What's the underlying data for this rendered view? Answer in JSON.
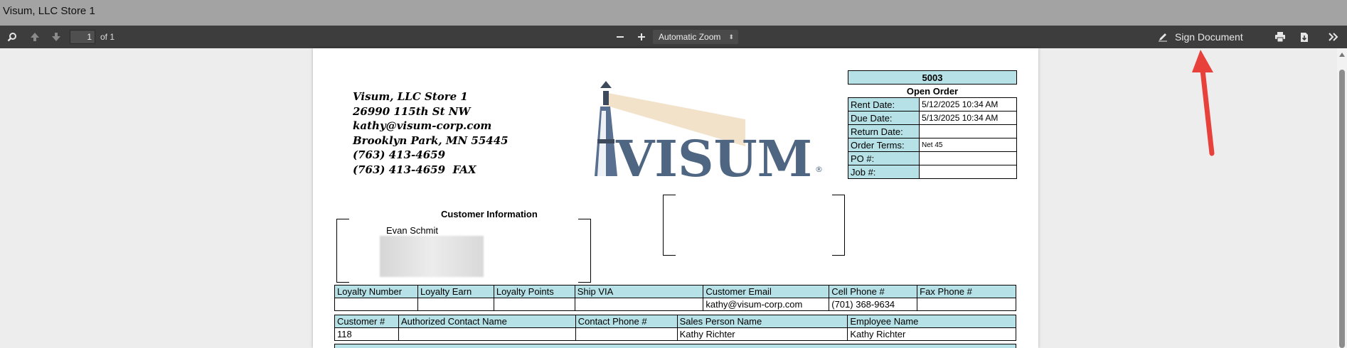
{
  "window": {
    "title": "Visum, LLC Store 1"
  },
  "toolbar": {
    "page_current": "1",
    "page_of": "of 1",
    "zoom_label": "Automatic Zoom",
    "sign_label": "Sign Document"
  },
  "store": {
    "name": "Visum, LLC Store 1",
    "street": "26990 115th St NW",
    "email": "kathy@visum-corp.com",
    "city": "Brooklyn Park, MN 55445",
    "phone": "(763) 413-4659",
    "fax": "(763) 413-4659  FAX"
  },
  "logo": {
    "text": "VISUM",
    "mark": "®"
  },
  "order": {
    "number": "5003",
    "status": "Open Order",
    "rows": [
      {
        "label": "Rent Date:",
        "value": "5/12/2025 10:34 AM"
      },
      {
        "label": "Due Date:",
        "value": "5/13/2025 10:34 AM"
      },
      {
        "label": "Return Date:",
        "value": ""
      },
      {
        "label": "Order Terms:",
        "value": "Net 45"
      },
      {
        "label": "PO #:",
        "value": ""
      },
      {
        "label": "Job #:",
        "value": ""
      }
    ]
  },
  "customer": {
    "title": "Customer Information",
    "name": "Evan Schmit"
  },
  "loyalty": {
    "headers": [
      "Loyalty Number",
      "Loyalty Earn",
      "Loyalty Points",
      "Ship VIA",
      "Customer Email",
      "Cell Phone #",
      "Fax Phone #"
    ],
    "values": [
      "",
      "",
      "",
      "",
      "kathy@visum-corp.com",
      "(701) 368-9634",
      ""
    ]
  },
  "contact": {
    "headers": [
      "Customer #",
      "Authorized Contact Name",
      "Contact Phone #",
      "Sales Person Name",
      "Employee Name"
    ],
    "values": [
      "118",
      "",
      "",
      "Kathy Richter",
      "Kathy Richter"
    ]
  },
  "colors": {
    "header_fill": "#b6e1e6",
    "toolbar": "#3d3d3d",
    "titlebar": "#a3a3a3",
    "arrow": "#e8413c"
  }
}
